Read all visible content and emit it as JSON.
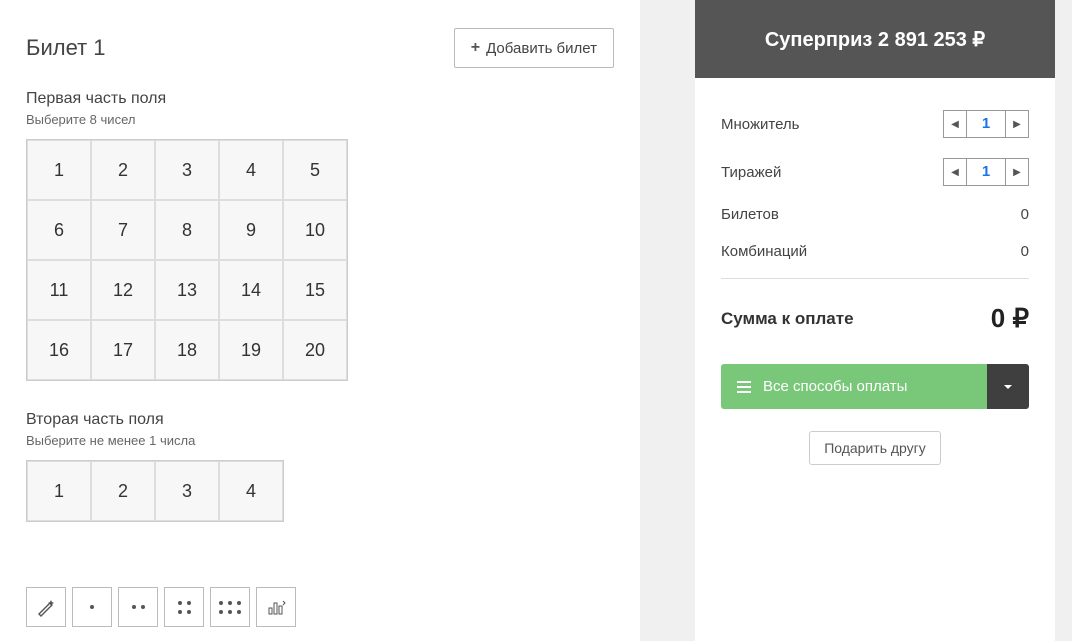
{
  "ticket": {
    "title": "Билет 1",
    "add_label": "Добавить билет"
  },
  "field1": {
    "title": "Первая часть поля",
    "subtitle": "Выберите 8 чисел",
    "numbers": [
      "1",
      "2",
      "3",
      "4",
      "5",
      "6",
      "7",
      "8",
      "9",
      "10",
      "11",
      "12",
      "13",
      "14",
      "15",
      "16",
      "17",
      "18",
      "19",
      "20"
    ]
  },
  "field2": {
    "title": "Вторая часть поля",
    "subtitle": "Выберите не менее 1 числа",
    "numbers": [
      "1",
      "2",
      "3",
      "4"
    ]
  },
  "prize_banner": "Суперприз 2 891 253 ₽",
  "summary": {
    "multiplier_label": "Множитель",
    "multiplier_value": "1",
    "draws_label": "Тиражей",
    "draws_value": "1",
    "tickets_label": "Билетов",
    "tickets_value": "0",
    "combos_label": "Комбинаций",
    "combos_value": "0"
  },
  "total": {
    "label": "Сумма к оплате",
    "value": "0 ₽"
  },
  "pay": {
    "label": "Все способы оплаты"
  },
  "gift": {
    "label": "Подарить другу"
  }
}
